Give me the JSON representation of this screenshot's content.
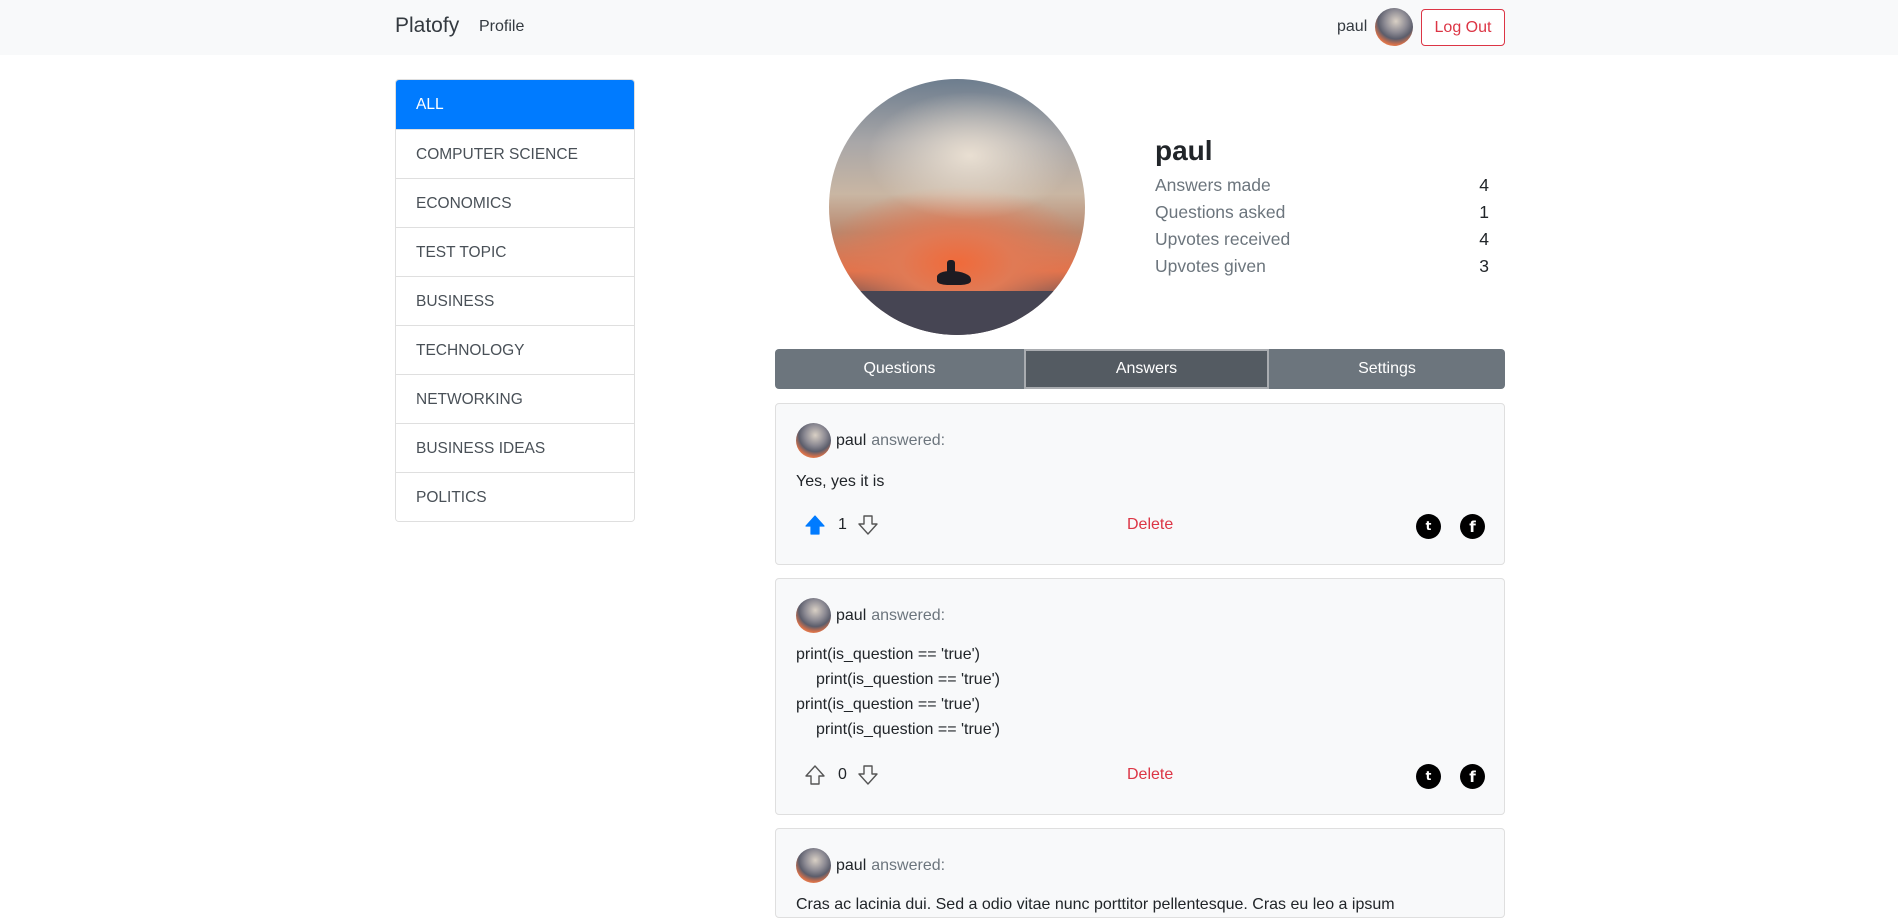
{
  "navbar": {
    "brand": "Platofy",
    "profile_link": "Profile",
    "username": "paul",
    "logout_label": "Log Out"
  },
  "sidebar": {
    "items": [
      {
        "label": "ALL",
        "active": true
      },
      {
        "label": "COMPUTER SCIENCE"
      },
      {
        "label": "ECONOMICS"
      },
      {
        "label": "TEST TOPIC"
      },
      {
        "label": "BUSINESS"
      },
      {
        "label": "TECHNOLOGY"
      },
      {
        "label": "NETWORKING"
      },
      {
        "label": "BUSINESS IDEAS"
      },
      {
        "label": "POLITICS"
      }
    ]
  },
  "profile": {
    "name": "paul",
    "stats": [
      {
        "label": "Answers made",
        "value": "4"
      },
      {
        "label": "Questions asked",
        "value": "1"
      },
      {
        "label": "Upvotes received",
        "value": "4"
      },
      {
        "label": "Upvotes given",
        "value": "3"
      }
    ]
  },
  "tabs": [
    {
      "label": "Questions"
    },
    {
      "label": "Answers",
      "active": true
    },
    {
      "label": "Settings"
    }
  ],
  "answers": [
    {
      "user": "paul",
      "answered_label": "answered:",
      "lines": [
        "Yes, yes it is"
      ],
      "votes": "1",
      "upvoted": true,
      "delete_label": "Delete"
    },
    {
      "user": "paul",
      "answered_label": "answered:",
      "lines": [
        "print(is_question == 'true')",
        "print(is_question == 'true')",
        "print(is_question == 'true')",
        "print(is_question == 'true')"
      ],
      "votes": "0",
      "upvoted": false,
      "delete_label": "Delete"
    },
    {
      "user": "paul",
      "answered_label": "answered:",
      "lines": [
        "Cras ac lacinia dui. Sed a odio vitae nunc porttitor pellentesque. Cras eu leo a ipsum"
      ]
    }
  ],
  "colors": {
    "primary": "#007bff",
    "danger": "#dc3545",
    "tab_bg": "#6c757d",
    "tab_active_bg": "#545b62",
    "card_bg": "#f8f9fa"
  },
  "icons": {
    "upvote": "arrow-up-icon",
    "downvote": "arrow-down-icon",
    "twitter": "twitter-icon",
    "facebook": "facebook-icon"
  }
}
